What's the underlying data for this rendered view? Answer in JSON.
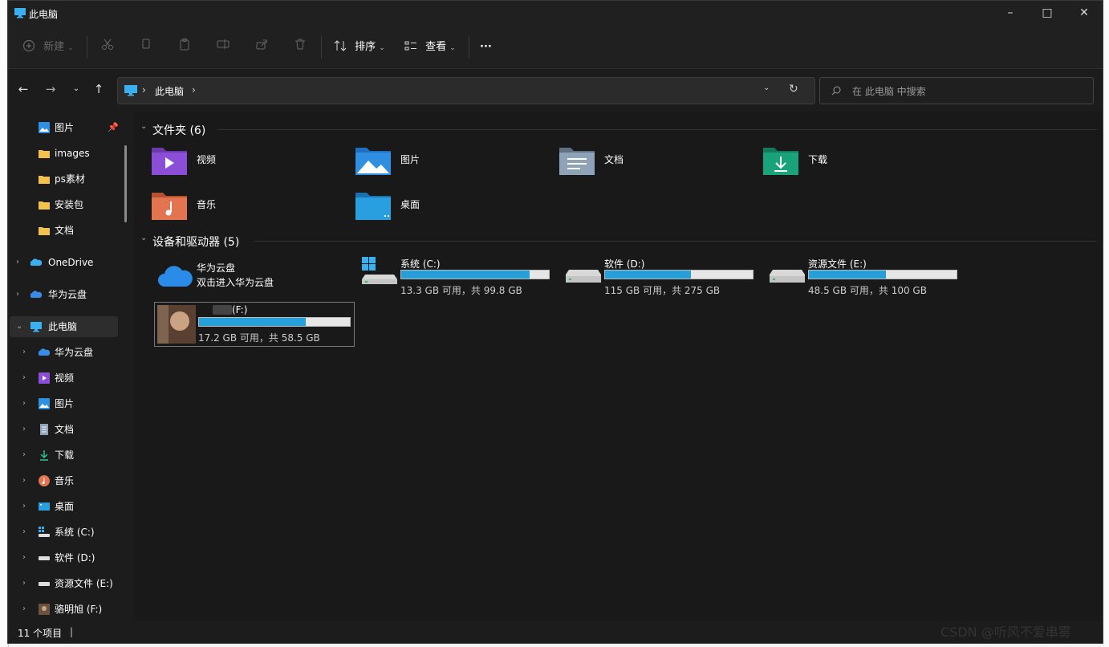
{
  "window": {
    "title": "此电脑"
  },
  "toolbar": {
    "new_label": "新建",
    "sort_label": "排序",
    "view_label": "查看",
    "more_label": "···"
  },
  "address": {
    "path": "此电脑"
  },
  "search": {
    "placeholder": "在 此电脑 中搜索"
  },
  "sidebar": {
    "quick": [
      {
        "label": "图片",
        "icon": "pictures-icon"
      },
      {
        "label": "images",
        "icon": "folder-icon"
      },
      {
        "label": "ps素材",
        "icon": "folder-icon"
      },
      {
        "label": "安装包",
        "icon": "folder-icon"
      },
      {
        "label": "文档",
        "icon": "folder-icon"
      }
    ],
    "onedrive": "OneDrive",
    "huawei": "华为云盘",
    "thispc": "此电脑",
    "pc_children": [
      {
        "label": "华为云盘",
        "icon": "cloud-icon"
      },
      {
        "label": "视频",
        "icon": "videos-icon"
      },
      {
        "label": "图片",
        "icon": "pictures-icon"
      },
      {
        "label": "文档",
        "icon": "documents-icon"
      },
      {
        "label": "下载",
        "icon": "downloads-icon"
      },
      {
        "label": "音乐",
        "icon": "music-icon"
      },
      {
        "label": "桌面",
        "icon": "desktop-icon"
      },
      {
        "label": "系统 (C:)",
        "icon": "windows-drive-icon"
      },
      {
        "label": "软件 (D:)",
        "icon": "drive-icon"
      },
      {
        "label": "资源文件 (E:)",
        "icon": "drive-icon"
      },
      {
        "label": "骆明旭 (F:)",
        "icon": "photo-drive-icon"
      }
    ]
  },
  "main": {
    "folders_header": "文件夹 (6)",
    "folders": [
      {
        "label": "视频",
        "icon": "videos-folder-icon",
        "color": "#8a4fd6"
      },
      {
        "label": "图片",
        "icon": "pictures-folder-icon",
        "color": "#2f8fe0"
      },
      {
        "label": "文档",
        "icon": "documents-folder-icon",
        "color": "#7f92a8"
      },
      {
        "label": "下载",
        "icon": "downloads-folder-icon",
        "color": "#1aa37a"
      },
      {
        "label": "音乐",
        "icon": "music-folder-icon",
        "color": "#e2744f"
      },
      {
        "label": "桌面",
        "icon": "desktop-folder-icon",
        "color": "#2a9fe0"
      }
    ],
    "devices_header": "设备和驱动器 (5)",
    "huawei": {
      "name": "华为云盘",
      "sub": "双击进入华为云盘"
    },
    "drives": [
      {
        "name": "系统 (C:)",
        "size": "13.3 GB 可用，共 99.8 GB",
        "used": 0.87
      },
      {
        "name": "软件 (D:)",
        "size": "115 GB 可用，共 275 GB",
        "used": 0.58
      },
      {
        "name": "资源文件 (E:)",
        "size": "48.5 GB 可用，共 100 GB",
        "used": 0.52
      },
      {
        "name": "(F:)",
        "size": "17.2 GB 可用，共 58.5 GB",
        "used": 0.71
      }
    ]
  },
  "status": {
    "items": "11 个项目"
  },
  "watermark": "CSDN @听风不爱串雾",
  "colors": {
    "accent": "#26a0da",
    "background": "#191919"
  }
}
